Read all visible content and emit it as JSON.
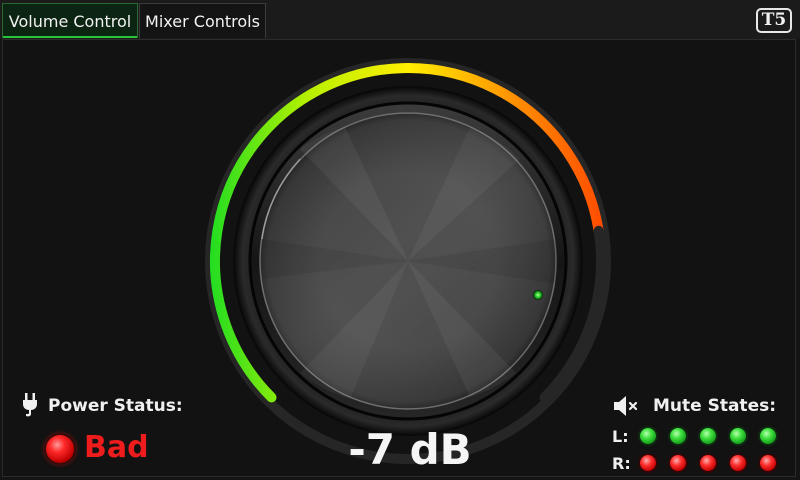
{
  "tabs": [
    {
      "label": "Volume Control",
      "active": true
    },
    {
      "label": "Mixer Controls",
      "active": false
    }
  ],
  "logo": {
    "text": "T5"
  },
  "volume": {
    "readout": "-7 dB",
    "level_fraction": 0.8,
    "arc_gradient": [
      "#22dd22",
      "#b8f000",
      "#ffee00",
      "#ff8c00",
      "#ff4a00"
    ]
  },
  "power": {
    "label": "Power Status:",
    "value": "Bad",
    "icon": "plug-icon",
    "status_color": "#ee1c1c"
  },
  "mute": {
    "label": "Mute States:",
    "icon": "speaker-muted-icon",
    "left_label": "L:",
    "right_label": "R:",
    "left_states": [
      "on",
      "on",
      "on",
      "on",
      "on"
    ],
    "right_states": [
      "muted",
      "muted",
      "muted",
      "muted",
      "muted"
    ]
  }
}
